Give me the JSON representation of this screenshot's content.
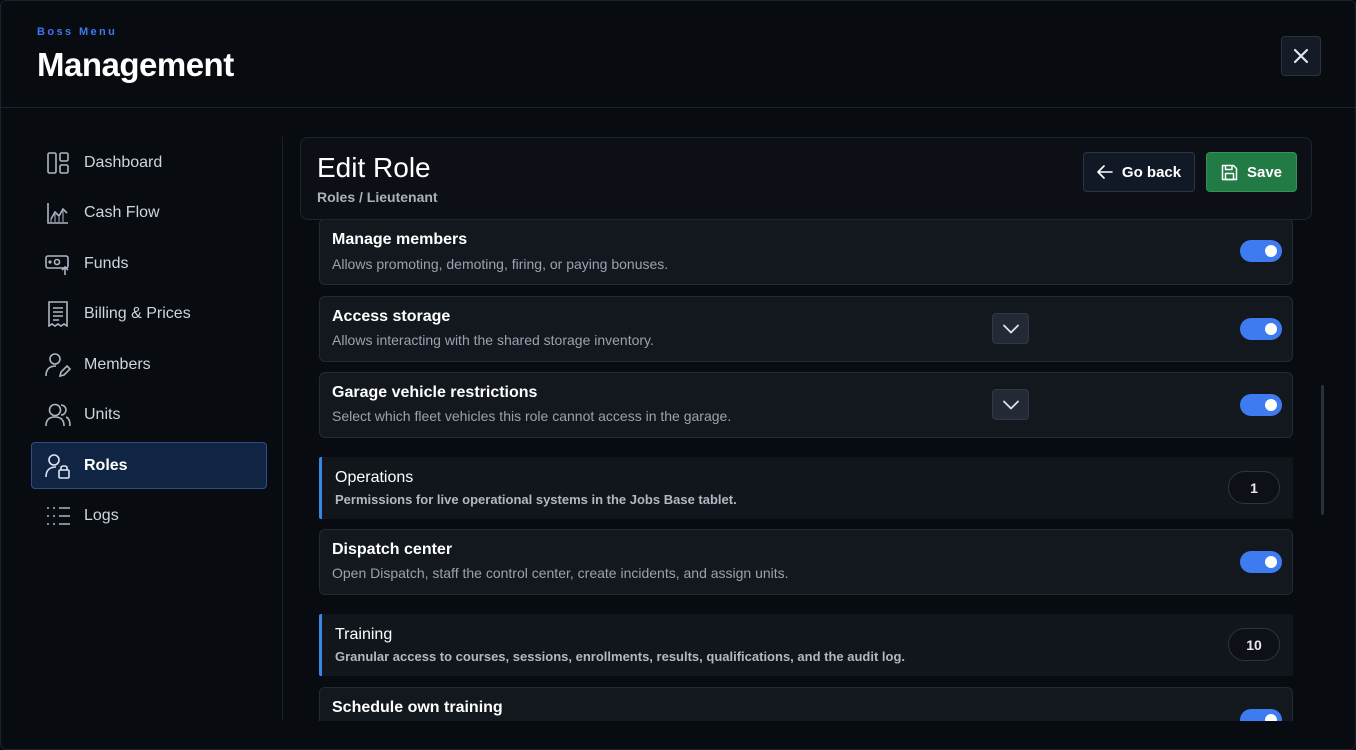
{
  "header": {
    "kicker": "Boss Menu",
    "title": "Management",
    "close_icon": "close-icon"
  },
  "sidebar": {
    "items": [
      {
        "label": "Dashboard",
        "icon": "dashboard-icon",
        "active": false
      },
      {
        "label": "Cash Flow",
        "icon": "chart-icon",
        "active": false
      },
      {
        "label": "Funds",
        "icon": "money-transfer-icon",
        "active": false
      },
      {
        "label": "Billing & Prices",
        "icon": "receipt-icon",
        "active": false
      },
      {
        "label": "Members",
        "icon": "user-edit-icon",
        "active": false
      },
      {
        "label": "Units",
        "icon": "users-icon",
        "active": false
      },
      {
        "label": "Roles",
        "icon": "user-lock-icon",
        "active": true
      },
      {
        "label": "Logs",
        "icon": "list-icon",
        "active": false
      }
    ]
  },
  "edit": {
    "title": "Edit Role",
    "breadcrumb": "Roles / Lieutenant",
    "back_label": "Go back",
    "save_label": "Save"
  },
  "permissions": {
    "manage_members": {
      "title": "Manage members",
      "desc": "Allows promoting, demoting, firing, or paying bonuses.",
      "enabled": true
    },
    "access_storage": {
      "title": "Access storage",
      "desc": "Allows interacting with the shared storage inventory.",
      "enabled": true
    },
    "garage_restrictions": {
      "title": "Garage vehicle restrictions",
      "desc": "Select which fleet vehicles this role cannot access in the garage.",
      "enabled": true
    },
    "dispatch_center": {
      "title": "Dispatch center",
      "desc": "Open Dispatch, staff the control center, create incidents, and assign units.",
      "enabled": true
    },
    "schedule_training": {
      "title": "Schedule own training",
      "desc": "",
      "enabled": true
    }
  },
  "sections": {
    "operations": {
      "title": "Operations",
      "desc": "Permissions for live operational systems in the Jobs Base tablet.",
      "count": "1"
    },
    "training": {
      "title": "Training",
      "desc": "Granular access to courses, sessions, enrollments, results, qualifications, and the audit log.",
      "count": "10"
    }
  },
  "colors": {
    "accent": "#3f7bf0",
    "save": "#227a45",
    "section_bar": "#3a86e8",
    "active_nav": "#102444"
  }
}
